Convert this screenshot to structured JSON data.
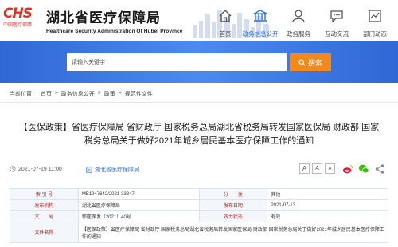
{
  "header": {
    "logo_mark": "CHS",
    "logo_sub": "中国医疗保障",
    "title": "湖北省医疗保障局",
    "subtitle_en": "Healthcare Security Administration Of Hubei Province"
  },
  "nav": [
    {
      "label": "首页",
      "icon": "home-icon"
    },
    {
      "label": "政务信息公开",
      "icon": "building-icon"
    },
    {
      "label": "政务服务",
      "icon": "service-icon"
    },
    {
      "label": "互动交流",
      "icon": "chat-icon"
    },
    {
      "label": "部门动态",
      "icon": "trend-icon"
    }
  ],
  "search": {
    "placeholder": "请输入关键字",
    "button_label": "搜索"
  },
  "breadcrumb": {
    "prefix": "当前位置：",
    "items": [
      "首页",
      "政务信息公开",
      "政策",
      "规范性文件"
    ],
    "separator": "»"
  },
  "article": {
    "title_line1": "【医保政策】省医疗保障局 省财政厅 国家税务总局湖北省税务局转发国家医保局 财政部 国家",
    "title_line2": "税务总局关于做好2021年城乡居民基本医疗保障工作的通知",
    "date": "2021-07-19 11:00",
    "source": "湖北省医疗保障局",
    "font_sizes": [
      "A",
      "A",
      "A"
    ]
  },
  "info": {
    "rows": [
      {
        "k1": "索 引 号",
        "v1": "MB1947642/2021-33347",
        "k2": "分　　类",
        "v2": "其他"
      },
      {
        "k1": "发布机构",
        "v1": "湖北省医疗保障局",
        "k2": "发布日期",
        "v2": "2021-07-13"
      },
      {
        "k1": "文　　号",
        "v1": "鄂医保发〔2021〕40号",
        "k2": "效力状态",
        "v2": "有效"
      }
    ],
    "doc_name_label": "文件名称",
    "doc_name": "【医保政策】省医疗保障局 省财政厅 国家税务总局湖北省税务局转发国家医保局 财政部 国家税务总局关于做好2021年城乡居民基本医疗保障工作的通知"
  },
  "colors": {
    "accent": "#2a6fdb",
    "brand_red": "#d9342b",
    "search_button": "#f08a1d"
  }
}
